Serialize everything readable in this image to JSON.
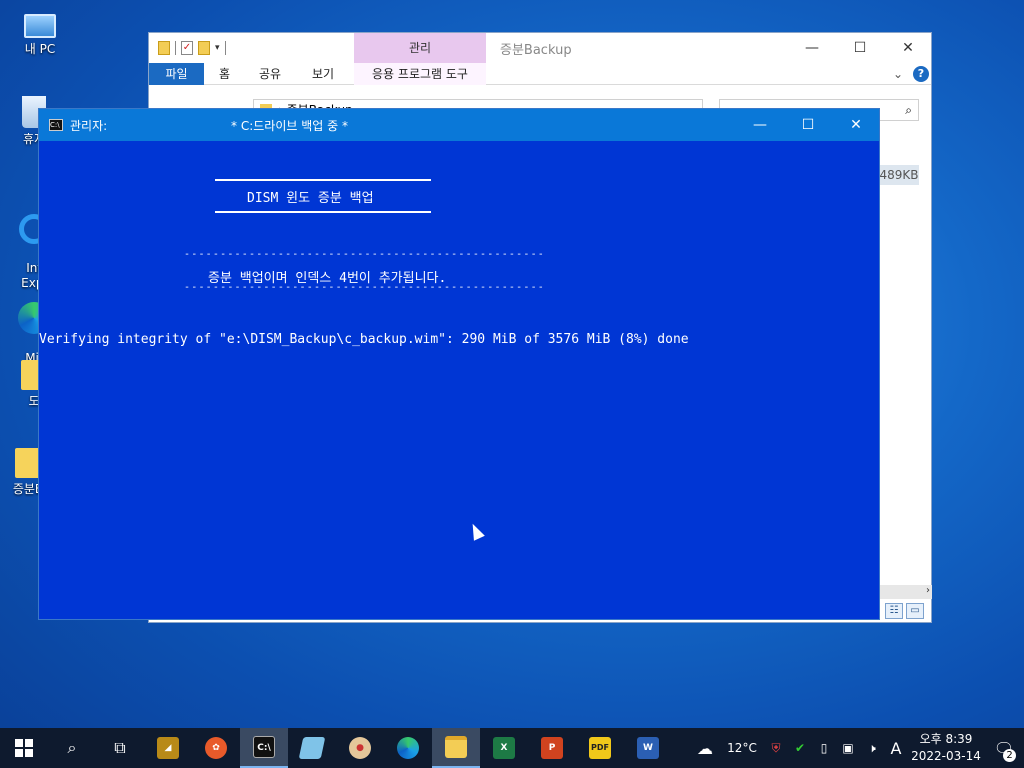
{
  "desktop": {
    "icons": [
      {
        "label": "내 PC",
        "icon": "computer-icon"
      },
      {
        "label": "휴지",
        "icon": "recycle-bin-icon"
      },
      {
        "label": "Inte\nExpl",
        "icon": "ie-icon"
      },
      {
        "label": "Micr\nEd",
        "icon": "edge-icon"
      },
      {
        "label": "도",
        "icon": "folder-icon"
      },
      {
        "label": "증분B",
        "icon": "folder-icon"
      }
    ]
  },
  "explorer": {
    "context_tab": "관리",
    "title": "증분Backup",
    "ribbon_tabs": [
      "파일",
      "홈",
      "공유",
      "보기",
      "응용 프로그램 도구"
    ],
    "address": "증분Backup",
    "size_value": "489KB"
  },
  "console": {
    "title_label": "관리자:",
    "caption": "*  C:드라이브 백업 중  *",
    "heading": "DISM 윈도 증분 백업",
    "dash_line": "--------------------------------------------------",
    "notice": "증분 백업이며 인덱스 4번이 추가됩니다.",
    "progress_line": "Verifying integrity of \"e:\\DISM_Backup\\c_backup.wim\": 290 MiB of 3576 MiB (8%) done"
  },
  "taskbar": {
    "weather": "12°C",
    "time": "오후 8:39",
    "date": "2022-03-14",
    "ime": "A",
    "notification_count": "2",
    "apps": [
      "start-icon",
      "search-icon",
      "task-view-icon",
      "app-gold-icon",
      "app-flower-icon",
      "cmd-icon",
      "app-book-icon",
      "paint-icon",
      "edge-icon",
      "file-explorer-icon",
      "excel-icon",
      "powerpoint-icon",
      "pdf-icon",
      "word-icon"
    ]
  }
}
